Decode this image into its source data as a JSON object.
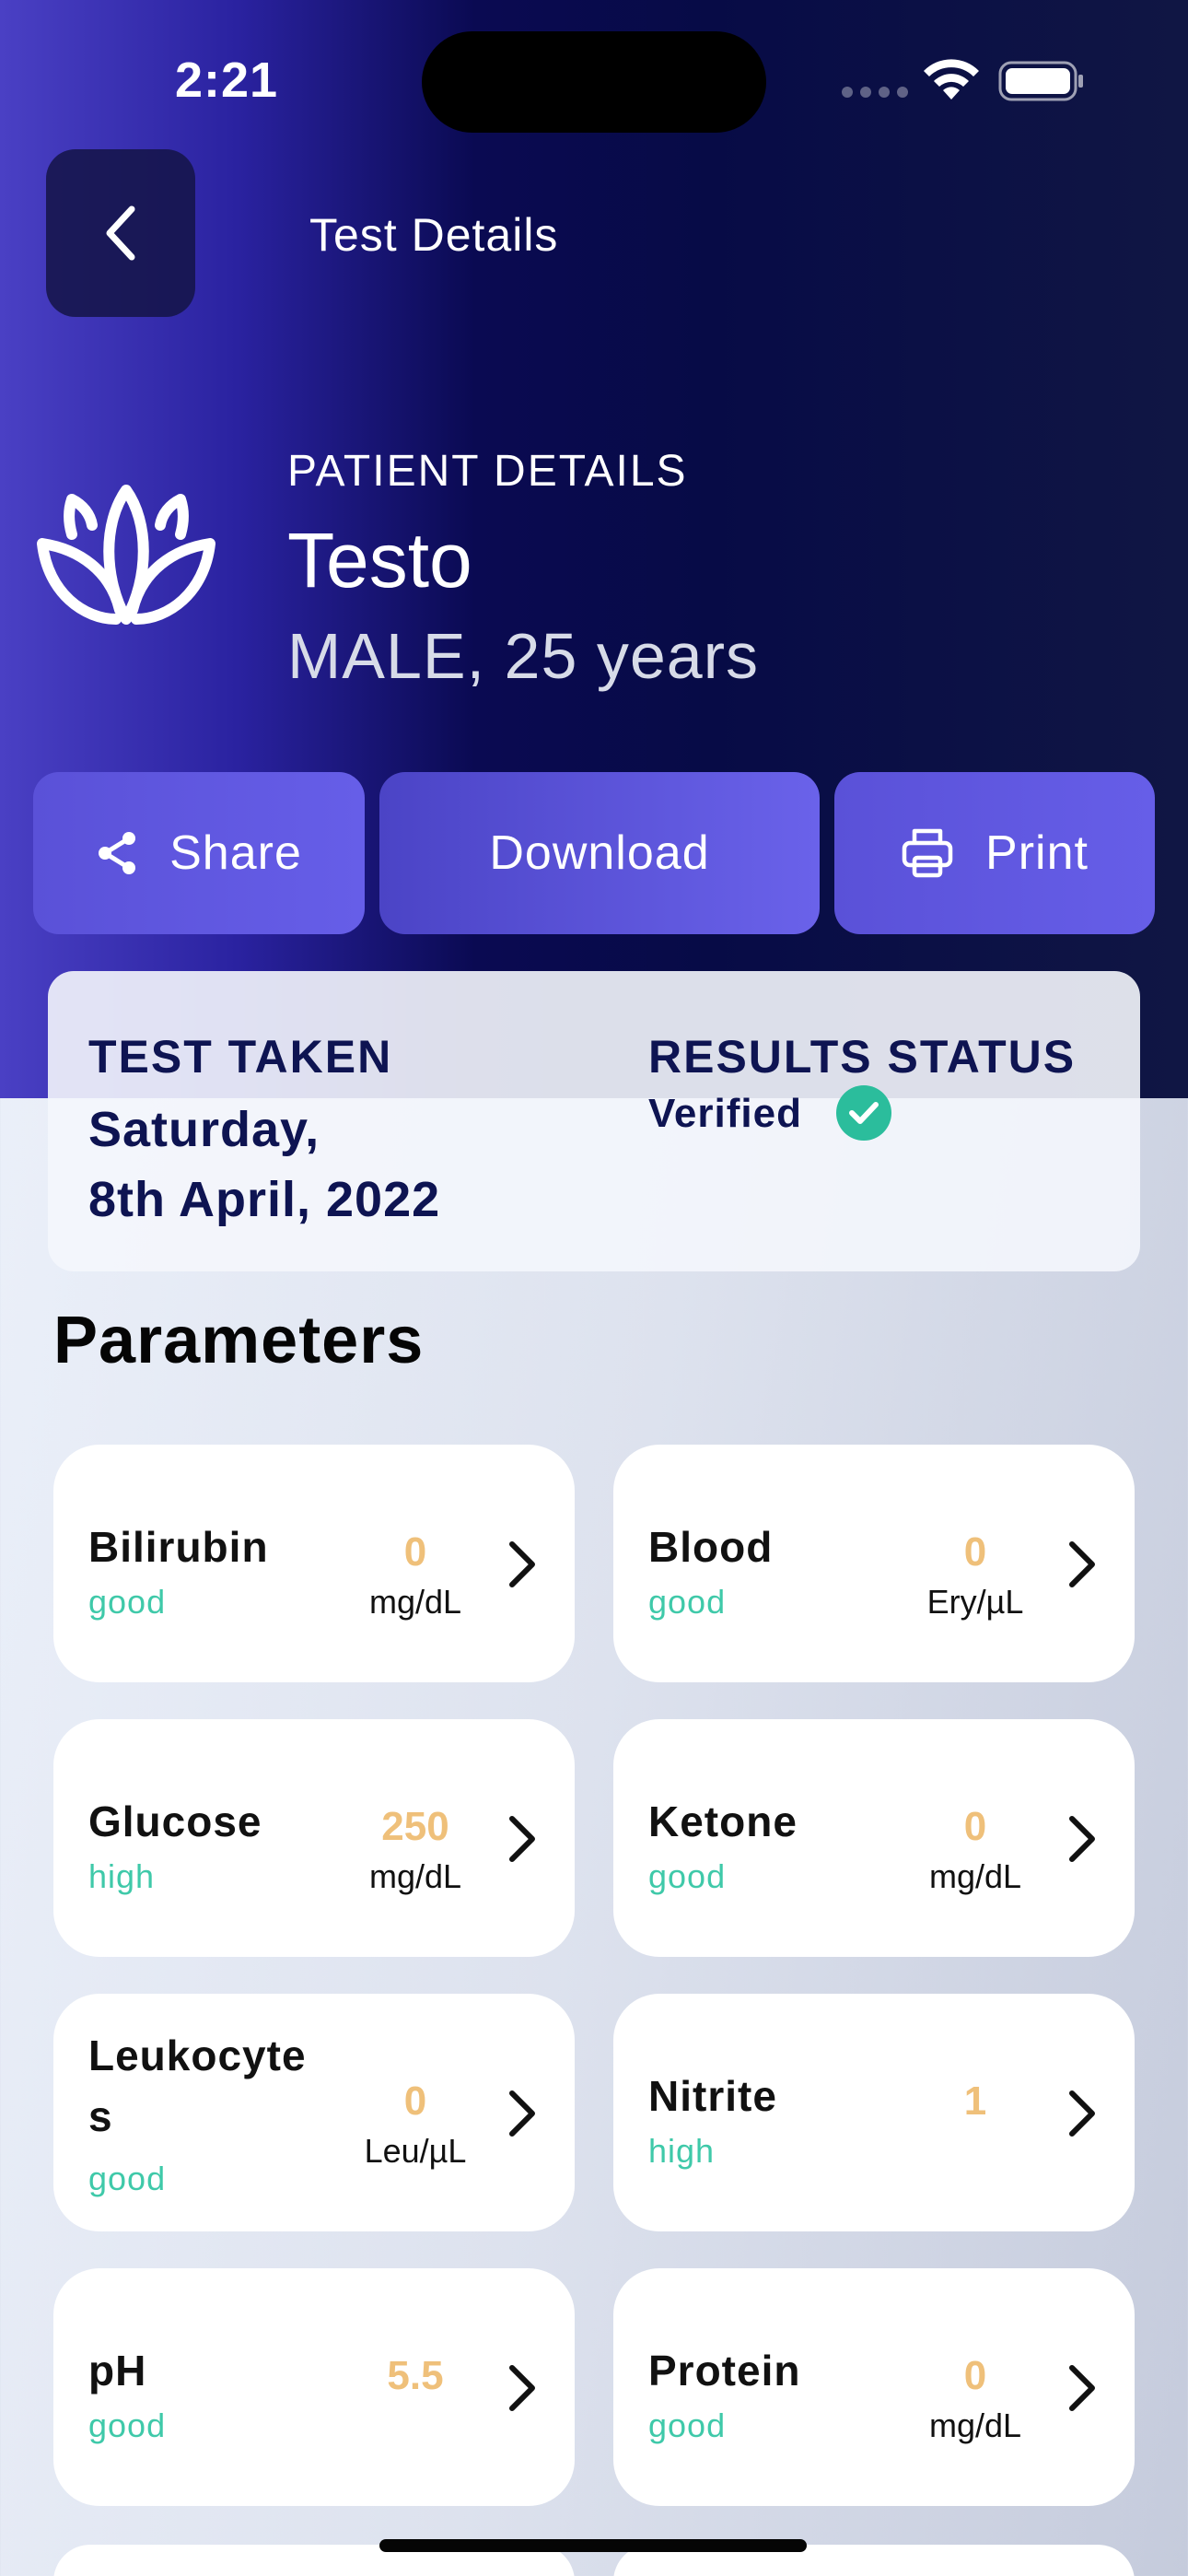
{
  "status_bar": {
    "time": "2:21"
  },
  "header": {
    "title": "Test Details"
  },
  "patient": {
    "caption": "PATIENT DETAILS",
    "name": "Testo",
    "meta": "MALE, 25 years"
  },
  "actions": {
    "share": "Share",
    "download": "Download",
    "print": "Print"
  },
  "test_info": {
    "taken_label": "TEST TAKEN",
    "taken_date_line1": "Saturday,",
    "taken_date_line2": "8th April, 2022",
    "status_label": "RESULTS STATUS",
    "status_value": "Verified"
  },
  "section_title": "Parameters",
  "parameters": [
    {
      "name": "Bilirubin",
      "status": "good",
      "value": "0",
      "unit": "mg/dL"
    },
    {
      "name": "Blood",
      "status": "good",
      "value": "0",
      "unit": "Ery/µL"
    },
    {
      "name": "Glucose",
      "status": "high",
      "value": "250",
      "unit": "mg/dL"
    },
    {
      "name": "Ketone",
      "status": "good",
      "value": "0",
      "unit": "mg/dL"
    },
    {
      "name": "Leukocytes",
      "status": "good",
      "value": "0",
      "unit": "Leu/µL"
    },
    {
      "name": "Nitrite",
      "status": "high",
      "value": "1",
      "unit": ""
    },
    {
      "name": "pH",
      "status": "good",
      "value": "5.5",
      "unit": ""
    },
    {
      "name": "Protein",
      "status": "good",
      "value": "0",
      "unit": "mg/dL"
    }
  ],
  "colors": {
    "accent": "#5a51d8",
    "status_good": "#3fc9a9",
    "value": "#efc07a",
    "verified": "#2bbd9c"
  }
}
